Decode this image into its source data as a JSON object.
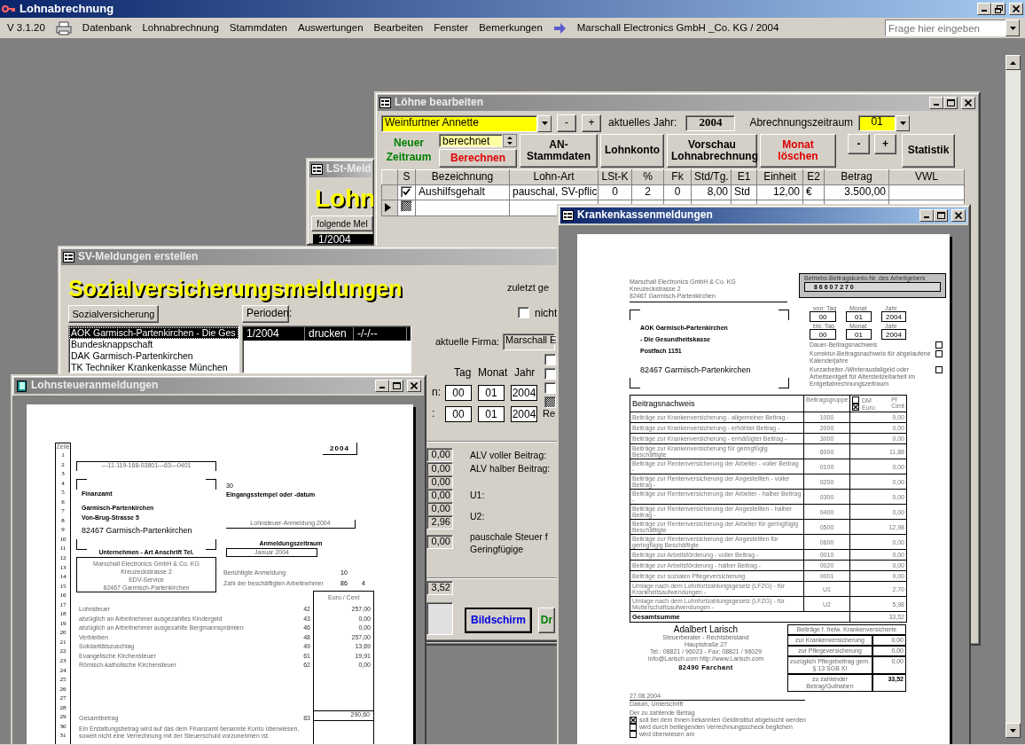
{
  "app": {
    "title": "Lohnabrechnung",
    "version": "V 3.1.20",
    "menu": [
      "Datenbank",
      "Lohnabrechnung",
      "Stammdaten",
      "Auswertungen",
      "Bearbeiten",
      "Fenster",
      "Bemerkungen"
    ],
    "company": "Marschall Electronics GmbH _Co. KG / 2004",
    "help_placeholder": "Frage hier eingeben"
  },
  "lst_window": {
    "title": "LSt-Meld",
    "active": false,
    "heading": "Lohn",
    "button": "folgende Mel",
    "list": [
      {
        "text": "1/2004",
        "selected": true
      }
    ]
  },
  "loehne_window": {
    "title": "Löhne bearbeiten",
    "active": false,
    "employee": "Weinfurtner Annette",
    "employee_steps": [
      "-",
      "+"
    ],
    "year_label": "aktuelles Jahr:",
    "year": "2004",
    "period_label": "Abrechnungszeitraum",
    "period": "01",
    "new_period": "Neuer Zeitraum",
    "status": "berechnet",
    "calculate": "Berechnen",
    "actions": [
      "AN-Stammdaten",
      "Lohnkonto",
      "Vorschau Lohnabrechnung"
    ],
    "delete_month": "Monat löschen",
    "month_steps": [
      "-",
      "+"
    ],
    "statistics": "Statistik",
    "columns": [
      "S",
      "Bezeichnung",
      "Lohn-Art",
      "LSt-K",
      "%",
      "Fk",
      "Std/Tg.",
      "E1",
      "Einheit",
      "E2",
      "Betrag",
      "VWL"
    ],
    "rows": [
      {
        "kind": "record",
        "current": false,
        "checked": true,
        "cells": [
          "Aushilfsgehalt",
          "pauschal, SV-pflic",
          "0",
          "2",
          "0",
          "8,00",
          "Std",
          "12,00",
          "€",
          "3.500,00"
        ]
      },
      {
        "kind": "new",
        "current": true
      }
    ]
  },
  "sv_window": {
    "title": "SV-Meldungen erstellen",
    "active": false,
    "heading": "Sozialversicherungsmeldungen",
    "last_created": "zuletzt ge",
    "insurer_button": "Sozialversicherung",
    "periods_button": "Perioden:",
    "not_option": {
      "label": "nicht",
      "checked": false
    },
    "insurers": [
      {
        "name": "AOK Garmisch-Partenkirchen - Die Ges",
        "selected": true
      },
      {
        "name": "Bundesknappschaft",
        "selected": false
      },
      {
        "name": "DAK Garmisch-Partenkirchen",
        "selected": false
      },
      {
        "name": "TK Techniker Krankenkasse München",
        "selected": false
      }
    ],
    "periods": [
      {
        "period": "1/2004",
        "action": "drucken",
        "date": "-/-/--",
        "selected": true
      }
    ],
    "company_label": "aktuelle Firma:",
    "company": "Marschall E",
    "flags": [
      {
        "indeterminate": false
      },
      {
        "indeterminate": false
      },
      {
        "indeterminate": false
      },
      {
        "indeterminate": true
      }
    ],
    "date_headers": [
      "Tag",
      "Monat",
      "Jahr"
    ],
    "date_rows": [
      {
        "label": "n:",
        "values": [
          "00",
          "01",
          "2004"
        ]
      },
      {
        "label": ":",
        "values": [
          "00",
          "01",
          "2004"
        ],
        "note": "Re"
      }
    ],
    "amounts": [
      "0,00",
      "0,00",
      "0,00",
      "0,00",
      "0,00",
      "2,96",
      "0,00"
    ],
    "amount_labels": [
      "ALV voller Beitrag:",
      "ALV halber Beitrag:",
      "U1:",
      "U2:",
      "pauschale Steuer f",
      "Geringfügige"
    ],
    "total": "3,52",
    "screen_button": "Bildschirm",
    "print_button": "Dr"
  },
  "lohnsteuer_window": {
    "title": "Lohnsteueranmeldungen",
    "active": false,
    "page": {
      "line_header": "Zeile",
      "line_numbers": [
        "1",
        "2",
        "3",
        "4",
        "5",
        "6",
        "7",
        "8",
        "9",
        "10",
        "11",
        "12",
        "13",
        "14",
        "15",
        "16",
        "17",
        "18",
        "19",
        "20",
        "21",
        "22",
        "23",
        "24",
        "25",
        "26",
        "27",
        "28",
        "29",
        "30",
        "31"
      ],
      "year": "2004",
      "tax_number": "—11-119-168-03801—63—0401",
      "office": [
        "Finanzamt",
        "Garmisch-Partenkirchen",
        "Von-Brug-Strasse 5",
        "82467 Garmisch-Partenkirchen"
      ],
      "stamp_code": "30",
      "stamp_label": "Eingangsstempel oder -datum",
      "form_title": "Lohnsteuer-Anmeldung 2004",
      "period_label": "Anmeldungszeitraum",
      "period": "Januar 2004",
      "employer_label": "Unternehmen - Art Anschrift Tel.",
      "employer": [
        "Marschall Electronics GmbH & Co. KG",
        "Kreuzeckstrasse 2",
        "EDV-Service",
        "82467 Garmisch-Partenkirchen"
      ],
      "corrected_label": "Berichtigte Anmeldung",
      "corrected_code": "10",
      "employees_label": "Zahl der beschäftigten Arbeitnehmer",
      "employees_code": "86",
      "employees": "4",
      "currency_header": "Euro / Cent",
      "amounts": [
        {
          "label": "Lohnsteuer",
          "code": "42",
          "value": "257,00"
        },
        {
          "label": "abzüglich an Arbeitnehmer ausgezahltes Kindergeld",
          "code": "43",
          "value": "0,00"
        },
        {
          "label": "abzüglich an Arbeitnehmer ausgezahlte Bergmannsprämien",
          "code": "46",
          "value": "0,00"
        },
        {
          "label": "Verbleiben",
          "code": "48",
          "value": "257,00"
        },
        {
          "label": "Solidaritätszuschlag",
          "code": "49",
          "value": "13,69"
        },
        {
          "label": "Evangelische Kirchensteuer",
          "code": "61",
          "value": "19,91"
        },
        {
          "label": "Römisch-katholische Kirchensteuer",
          "code": "62",
          "value": "0,00"
        }
      ],
      "total": {
        "label": "Gesamtbetrag",
        "code": "83",
        "value": "290,60"
      },
      "note": "Ein Erstattungsbetrag wird auf das dem Finanzamt benannte Konto überwiesen, soweit nicht eine Verrechnung mit der Steuerschuld vorzunehmen ist."
    }
  },
  "kk_window": {
    "title": "Krankenkassenmeldungen",
    "active": true,
    "page": {
      "sender": [
        "Marschall Electronics GmbH & Co. KG",
        "Kreuzeckstrasse 2",
        "82467 Garmisch-Partenkirchen"
      ],
      "account_label": "Betriebs-Beitragskonto-Nr. des Arbeitgebers",
      "account": "8 6 6 0 7 2 7 0",
      "recipient": [
        "AOK Garmisch-Partenkirchen",
        "- Die Gesundheitskasse",
        "Postfach 1151",
        "82467 Garmisch-Partenkirchen"
      ],
      "dates": [
        {
          "labels": [
            "von: Tag",
            "Monat",
            "Jahr"
          ],
          "values": [
            "00",
            "01",
            "2004"
          ]
        },
        {
          "labels": [
            "bis: Tag",
            "Monat",
            "Jahr"
          ],
          "values": [
            "00",
            "01",
            "2004"
          ]
        }
      ],
      "options": [
        {
          "label": "Dauer-Beitragsnachweis",
          "checked": false
        },
        {
          "label": "Korrektur-Beitragsnachweis für abgelaufene Kalenderjahre",
          "checked": false
        },
        {
          "label": "Kurzarbeiter-/Winterausfallgeld oder Arbeitsentgelt für Altersteilzeitarbeit im Entgeltabrechnungszeitraum",
          "checked": false
        }
      ],
      "table_title": "Beitragsnachweis",
      "group_header": "Beitragsgruppe",
      "currencies": [
        {
          "label": "DM",
          "selected": false
        },
        {
          "label": "Euro",
          "selected": true
        }
      ],
      "cent_header": [
        "Pf",
        "Cent"
      ],
      "rows": [
        {
          "label": "Beiträge zur Krankenversicherung - allgemeiner Beitrag -",
          "code": "1000",
          "value": "0,00"
        },
        {
          "label": "Beiträge zur Krankenversicherung - erhöhter Beitrag -",
          "code": "2000",
          "value": "0,00"
        },
        {
          "label": "Beiträge zur Krankenversicherung - ermäßigter Beitrag -",
          "code": "3000",
          "value": "0,00"
        },
        {
          "label": "Beiträge zur Krankenversicherung für geringfügig Beschäftigte",
          "code": "6000",
          "value": "11,88"
        },
        {
          "label": "Beiträge zur Rentenversicherung der Arbeiter - voller Beitrag -",
          "code": "0100",
          "value": "0,00"
        },
        {
          "label": "Beiträge zur Rentenversicherung der Angestellten - voller Beitrag -",
          "code": "0200",
          "value": "0,00"
        },
        {
          "label": "Beiträge zur Rentenversicherung der Arbeiter - halber Beitrag -",
          "code": "0300",
          "value": "0,00"
        },
        {
          "label": "Beiträge zur Rentenversicherung der Angestellten - halber Beitrag -",
          "code": "0400",
          "value": "0,00"
        },
        {
          "label": "Beiträge zur Rentenversicherung der Arbeiter für geringfügig Beschäftigte",
          "code": "0500",
          "value": "12,98"
        },
        {
          "label": "Beiträge zur Rentenversicherung der Angestellten für geringfügig Beschäftigte",
          "code": "0600",
          "value": "0,00"
        },
        {
          "label": "Beiträge zur Arbeitsförderung - voller Beitrag -",
          "code": "0010",
          "value": "0,00"
        },
        {
          "label": "Beiträge zur Arbeitsförderung - halber Beitrag -",
          "code": "0020",
          "value": "0,00"
        },
        {
          "label": "Beiträge zur sozialen Pflegeversicherung",
          "code": "0001",
          "value": "0,00"
        },
        {
          "label": "Umlage nach dem Lohnfortzahlungsgesetz (LFZG) - für Krankheitsaufwendungen -",
          "code": "U1",
          "value": "2,70"
        },
        {
          "label": "Umlage nach dem Lohnfortzahlungsgesetz (LFZG) - für Mutterschaftsaufwendungen -",
          "code": "U2",
          "value": "5,98"
        }
      ],
      "total": {
        "label": "Gesamtsumme",
        "value": "33,52"
      },
      "extra_group": "Beiträge f. freiw. Krankenversicherte",
      "extras": [
        {
          "label": "zur Krankenversicherung",
          "value": "0,00"
        },
        {
          "label": "zur Pflegeversicherung",
          "value": "0,00"
        },
        {
          "label": "zuzüglich Pflegebeitrag gem. § 13 SGB XI",
          "value": "0,00"
        },
        {
          "label": "zu zahlender Betrag/Guthaben",
          "value": "33,52"
        }
      ],
      "advisor": [
        "Adalbert Larisch",
        "Steuerberater - Rechtsbeistand",
        "Hauptstraße 27",
        "Tel.: 08821 / 96023 - Fax: 08821 / 96029",
        "info@Larisch.com http://www.Larisch.com",
        "82490 Farchant"
      ],
      "date": "27.08.2004",
      "signature_label": "Datum, Unterschrift",
      "payment_label": "Der zu zahlende Betrag",
      "payment": [
        {
          "label": "soll bei dem Ihnen bekannten Geldinstitut abgebucht werden",
          "checked": true
        },
        {
          "label": "wird durch beiliegenden Verrechnungsscheck beglichen",
          "checked": false
        },
        {
          "label": "wird überwiesen am",
          "checked": false
        }
      ]
    }
  }
}
